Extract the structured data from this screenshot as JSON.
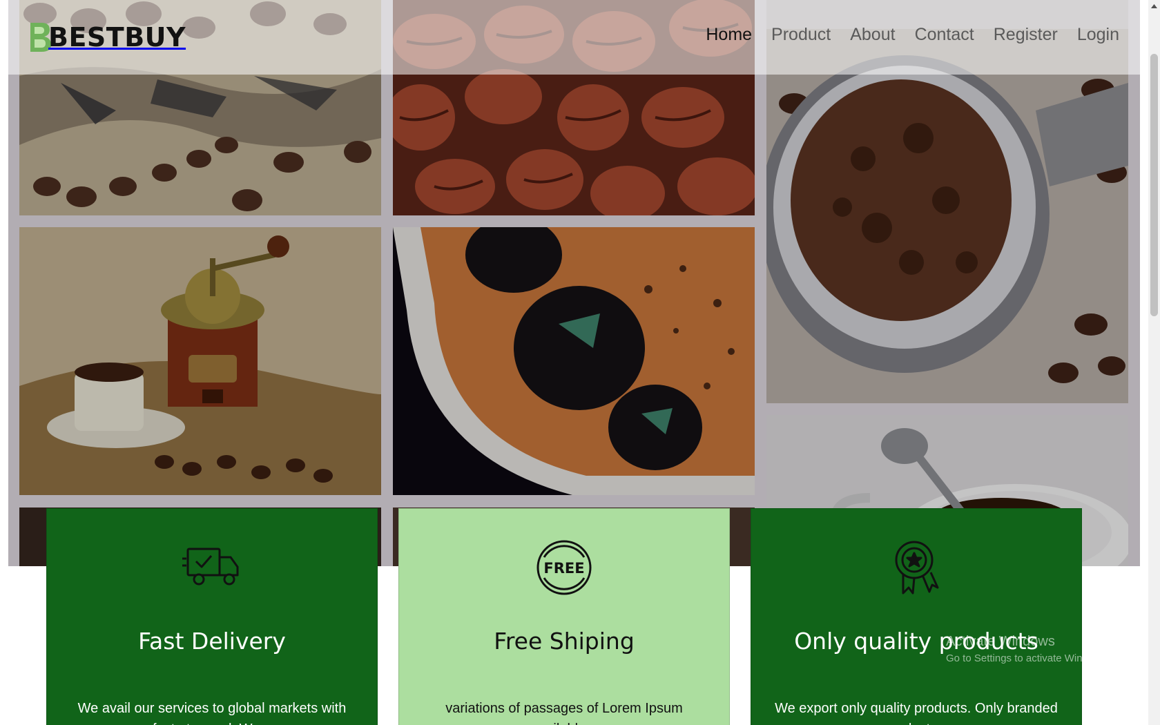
{
  "brand": {
    "name": "BESTBUY",
    "accent": "#116419"
  },
  "nav": {
    "items": [
      {
        "label": "Home",
        "active": true
      },
      {
        "label": "Product",
        "active": false
      },
      {
        "label": "About",
        "active": false
      },
      {
        "label": "Contact",
        "active": false
      },
      {
        "label": "Register",
        "active": false
      },
      {
        "label": "Login",
        "active": false
      }
    ]
  },
  "gallery": {
    "tiles": [
      {
        "name": "coffee-beans-burlap-photo",
        "icon": "coffee-beans-image"
      },
      {
        "name": "roasted-beans-closeup-photo",
        "icon": "coffee-beans-image"
      },
      {
        "name": "ground-coffee-portafilter-photo",
        "icon": "portafilter-image"
      },
      {
        "name": "coffee-grinder-photo",
        "icon": "grinder-image"
      },
      {
        "name": "espresso-crema-photo",
        "icon": "espresso-image"
      },
      {
        "name": "coffee-cup-spoon-photo",
        "icon": "cup-image"
      }
    ]
  },
  "features": [
    {
      "title": "Fast Delivery",
      "text": "We avail our services to global markets with fast at speed. We...",
      "icon": "delivery-truck-icon",
      "bg": "#116419"
    },
    {
      "title": "Free Shiping",
      "text": "variations of passages of Lorem Ipsum available...",
      "icon": "free-badge-icon",
      "bg": "#acde9f",
      "icon_text": "FREE"
    },
    {
      "title": "Only quality products",
      "text": "We export only quality products. Only branded products...",
      "icon": "award-ribbon-icon",
      "bg": "#116419"
    }
  ],
  "watermark": {
    "title": "Activate Windows",
    "subtitle": "Go to Settings to activate Windows."
  }
}
